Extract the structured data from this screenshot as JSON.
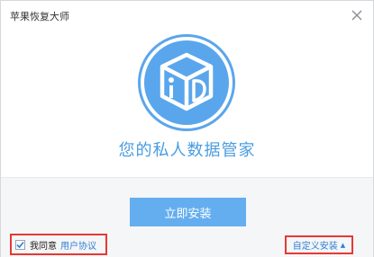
{
  "window": {
    "title": "苹果恢复大师"
  },
  "hero": {
    "icon": "cube-logo-icon",
    "tagline": "您的私人数据管家"
  },
  "footer": {
    "install_label": "立即安装",
    "agree_checked": true,
    "agree_text": "我同意",
    "agreement_link": "用户协议",
    "custom_install_label": "自定义安装",
    "custom_install_arrow": "▲"
  },
  "colors": {
    "accent": "#4a9ce0",
    "button": "#64aef0",
    "link": "#2f7fd6",
    "highlight_border": "#e53935"
  }
}
